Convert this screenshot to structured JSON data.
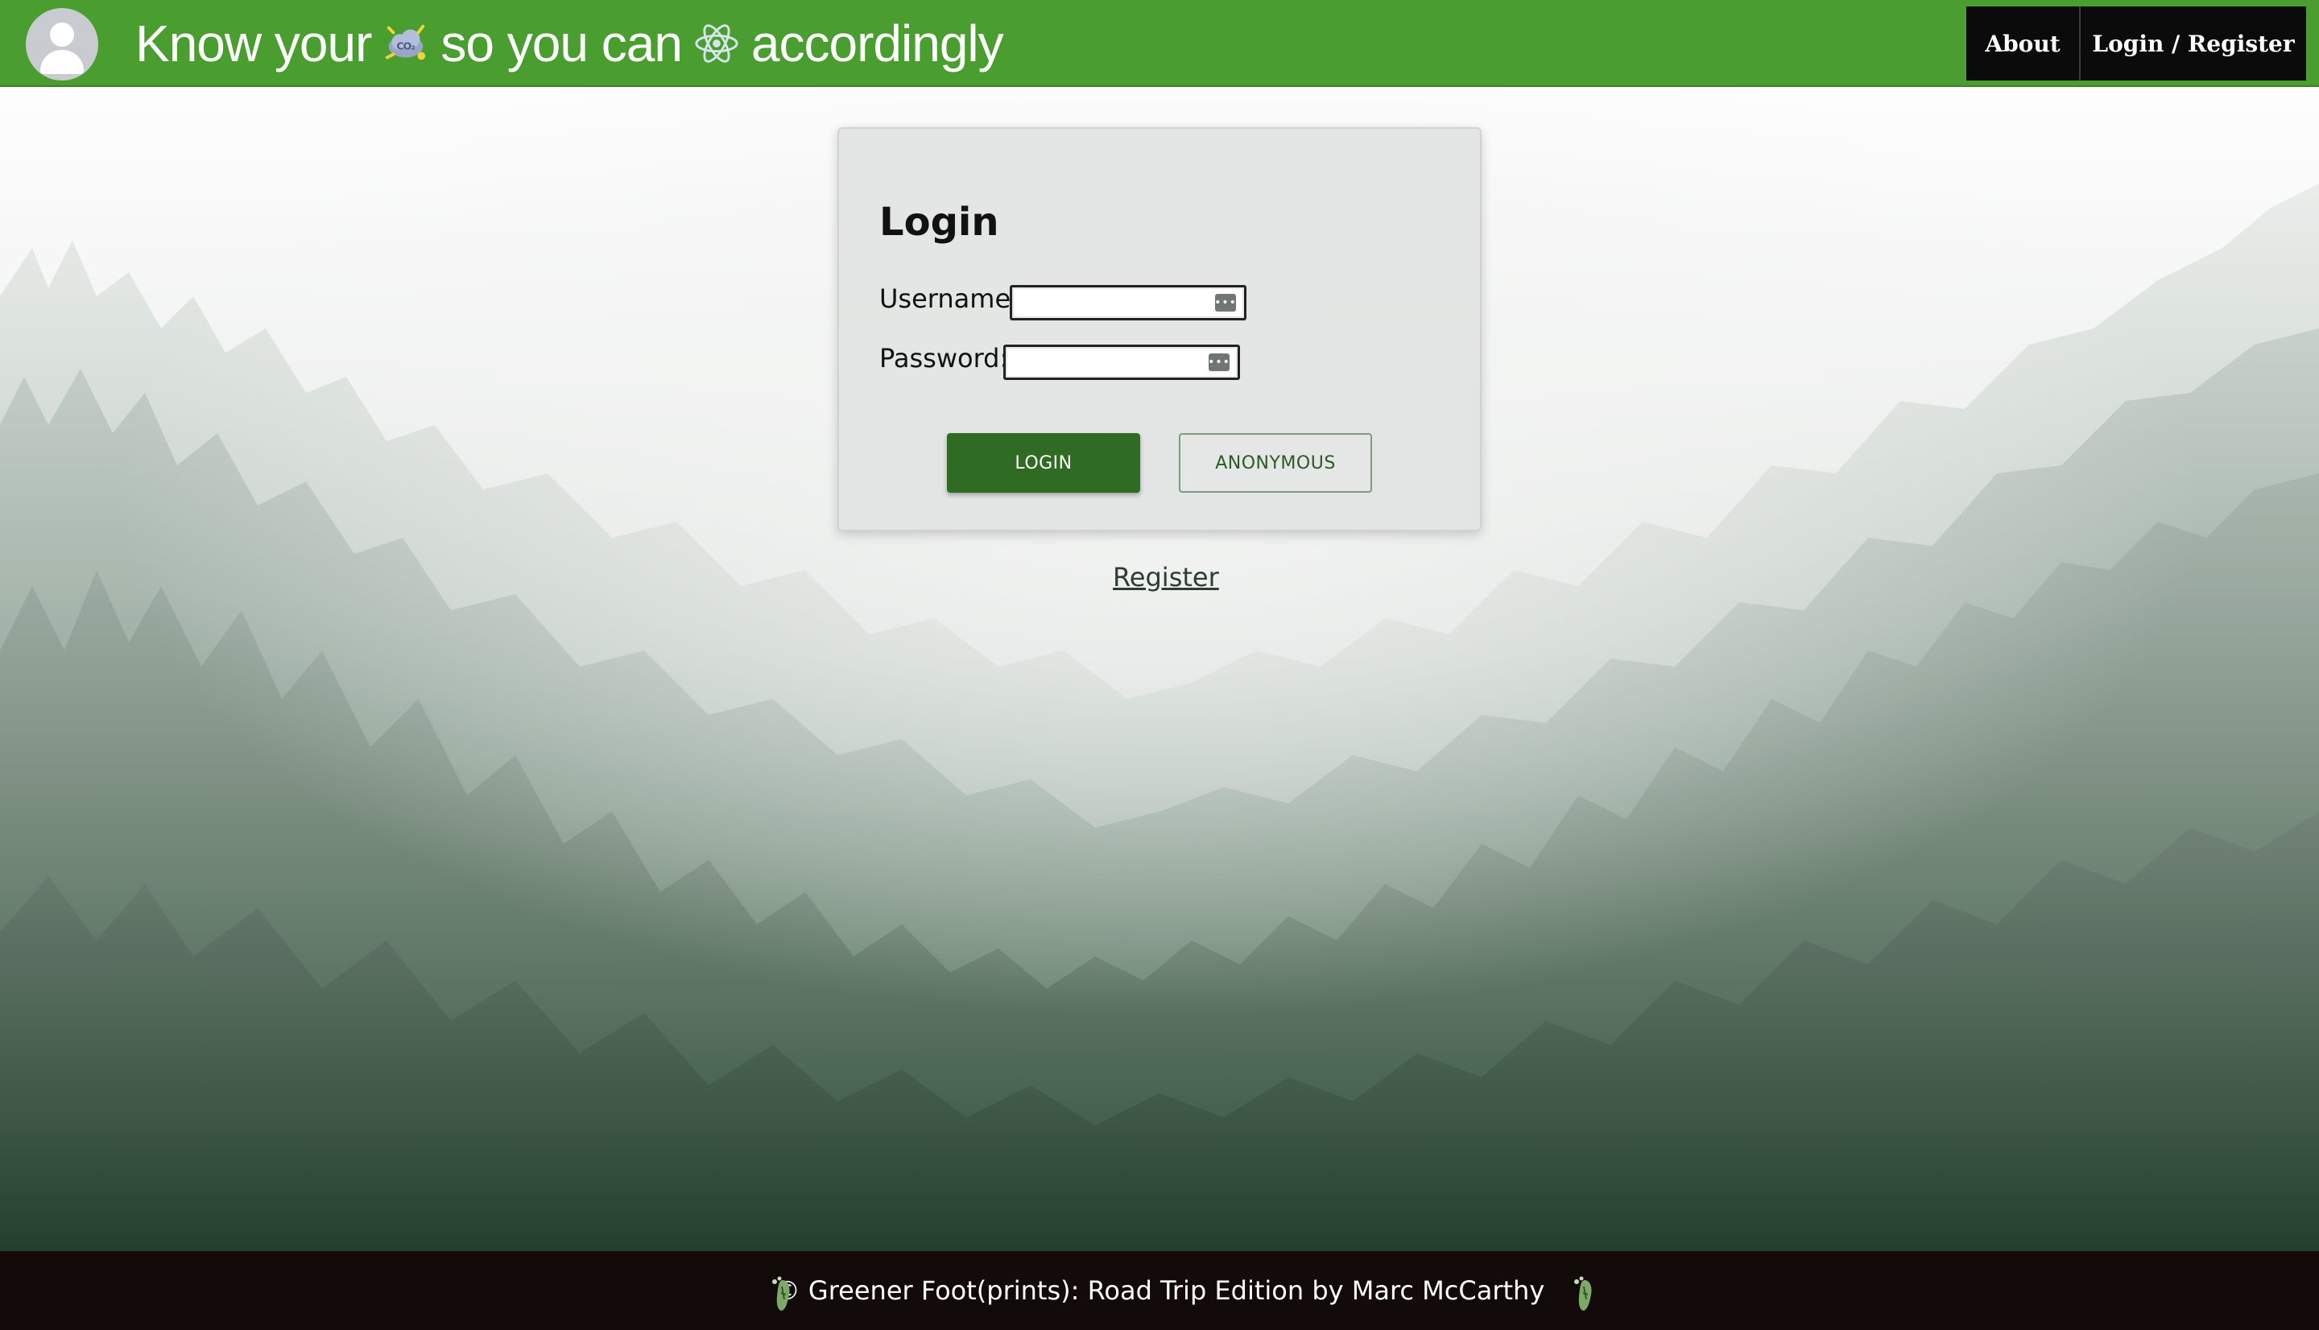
{
  "header": {
    "tagline": {
      "part1": "Know your",
      "icon1": "co2-cloud-icon",
      "part2": "so you can",
      "icon2": "atom-icon",
      "part3": "accordingly"
    },
    "nav": {
      "about": "About",
      "login_register": "Login / Register"
    },
    "colors": {
      "bar": "#4a9e2f",
      "nav_bg": "#0b0b0b"
    }
  },
  "login": {
    "title": "Login",
    "username_label": "Username:",
    "username_value": "",
    "password_label": "Password:",
    "password_value": "",
    "login_button": "LOGIN",
    "anonymous_button": "ANONYMOUS",
    "register_link": "Register",
    "colors": {
      "primary": "#2f6b22"
    }
  },
  "footer": {
    "text": "© Greener Foot(prints): Road Trip Edition by Marc McCarthy",
    "icon": "footprint-icon"
  }
}
